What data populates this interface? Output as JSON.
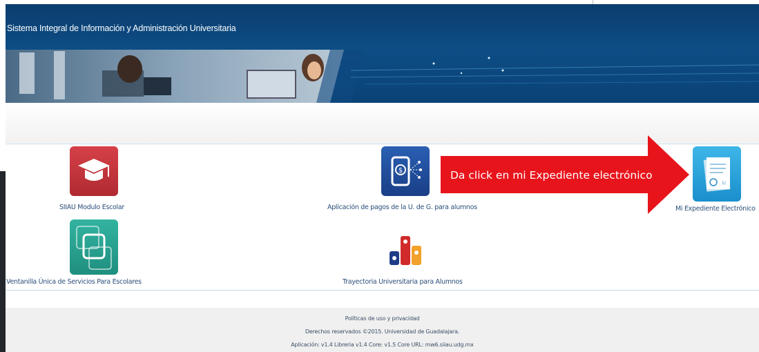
{
  "header": {
    "title": "Sistema Integral de Información y Administración Universitaria"
  },
  "apps": [
    {
      "label": "SIIAU Modulo Escolar",
      "icon": "graduation-cap-icon",
      "color": "#c8323a"
    },
    {
      "label": "Aplicación de pagos de la U. de G. para alumnos",
      "icon": "mobile-payment-icon",
      "color": "#1f4f9c"
    },
    {
      "label": "Mi Expediente Electrónico",
      "icon": "document-folder-icon",
      "color": "#1e9ad6"
    },
    {
      "label": "Ventanilla Única de Servicios Para Escolares",
      "icon": "stacked-squares-icon",
      "color": "#27a391"
    },
    {
      "label": "Trayectoria Universitaria para Alumnos",
      "icon": "bar-chart-icon",
      "color": "#d12a2a"
    }
  ],
  "annotation": {
    "text": "Da click en mi Expediente electrónico",
    "color": "#e8141c"
  },
  "footer": {
    "policy_link": "Políticas de uso y privacidad",
    "copyright": "Derechos reservados ©2015. Universidad de Guadalajara.",
    "version": "Aplicación: v1.4 Libreria v1.4 Core: v1.5 Core URL: mw6.siiau.udg.mx"
  }
}
